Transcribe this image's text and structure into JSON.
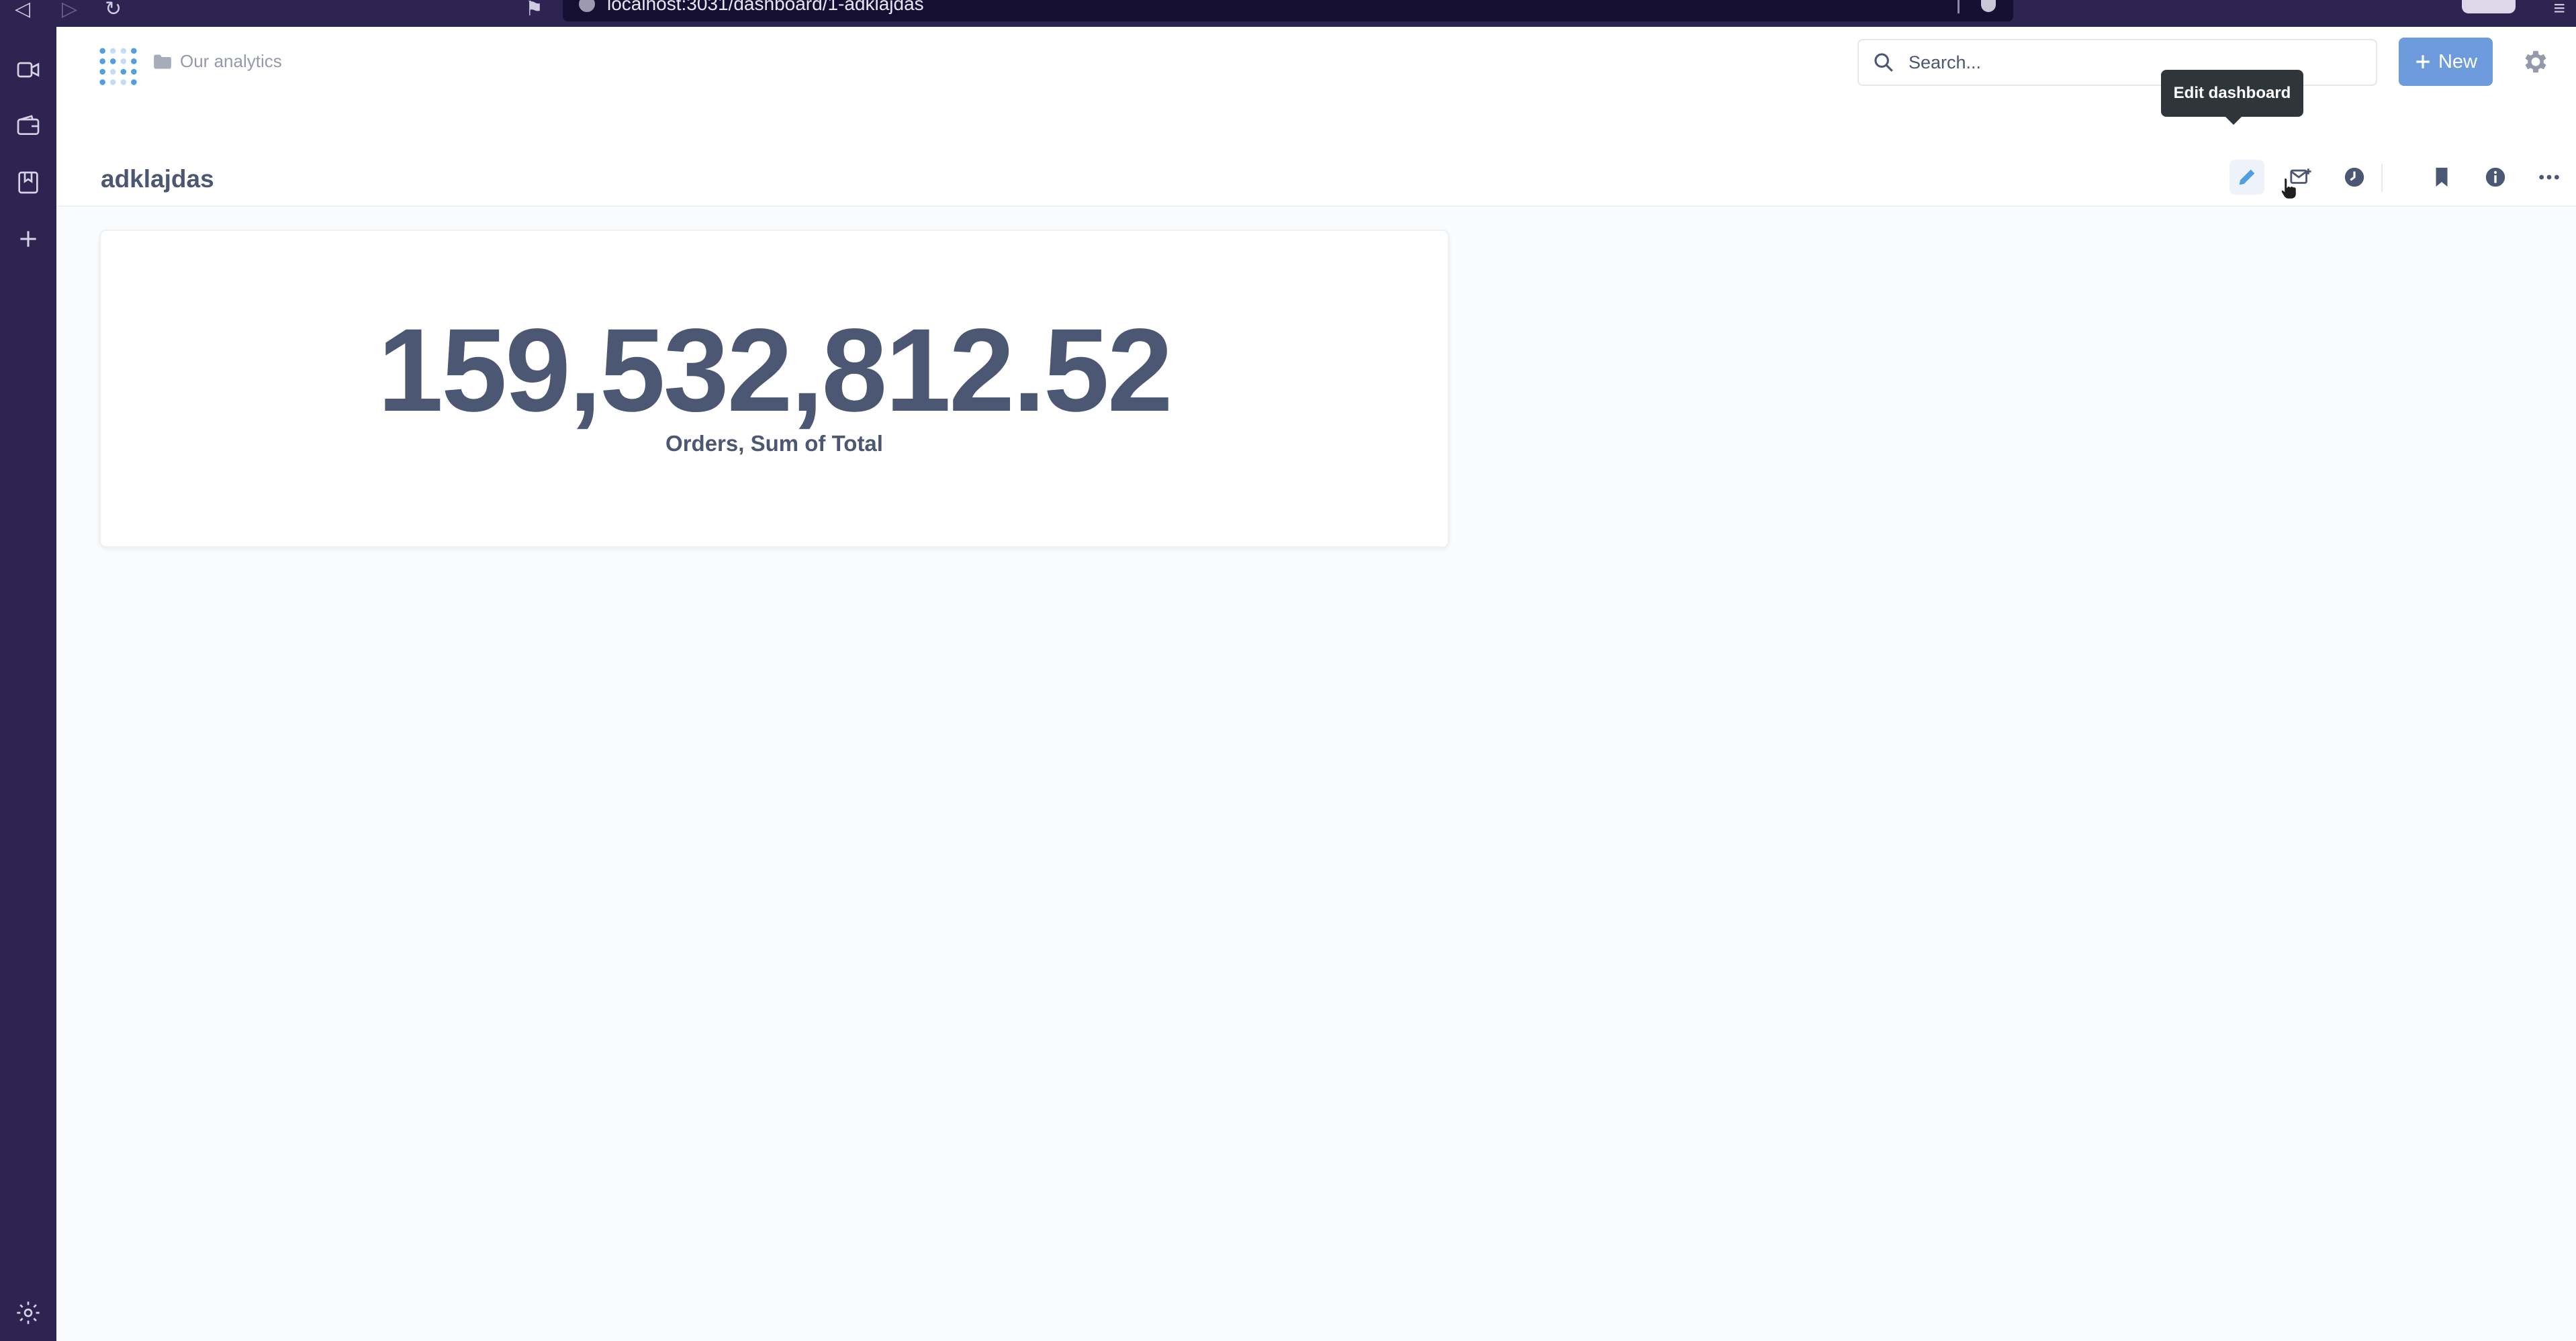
{
  "browser": {
    "url": "localhost:3031/dashboard/1-adklajdas"
  },
  "header": {
    "breadcrumb_collection": "Our analytics",
    "search_placeholder": "Search...",
    "new_label": "New"
  },
  "dashboard": {
    "title": "adklajdas",
    "tooltip": "Edit dashboard",
    "card": {
      "value": "159,532,812.52",
      "label": "Orders, Sum of Total"
    }
  },
  "icons": {
    "edit": "pencil-icon",
    "subscriptions": "mail-plus-icon",
    "history": "clock-icon",
    "bookmark": "bookmark-icon",
    "info": "info-icon",
    "more": "ellipsis-icon",
    "settings": "gear-icon",
    "search": "search-icon"
  },
  "colors": {
    "brand": "#509EE3",
    "new_button": "#6D9BDB",
    "text_dark": "#4C5773",
    "sidebar": "#2E2451"
  }
}
